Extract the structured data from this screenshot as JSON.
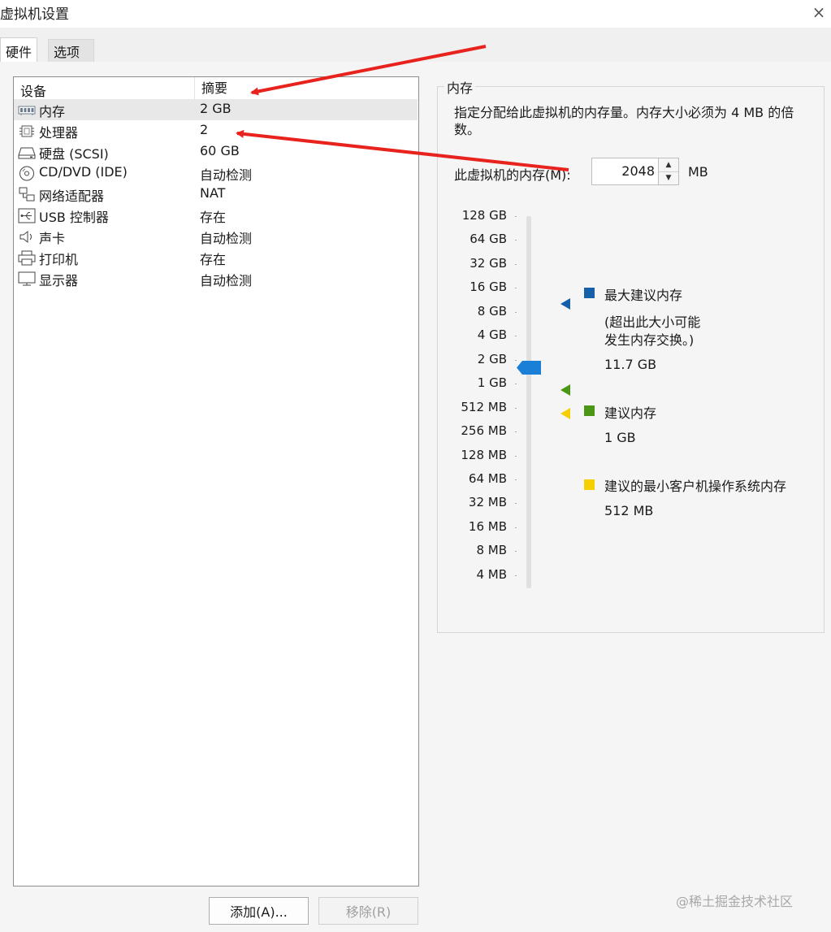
{
  "window": {
    "title": "虚拟机设置",
    "close_icon": "×"
  },
  "tabs": [
    {
      "label": "硬件",
      "active": true
    },
    {
      "label": "选项",
      "active": false
    }
  ],
  "device_table": {
    "headers": {
      "device": "设备",
      "summary": "摘要"
    },
    "rows": [
      {
        "name": "内存",
        "summary": "2 GB",
        "icon": "memory-icon",
        "selected": true
      },
      {
        "name": "处理器",
        "summary": "2",
        "icon": "processor-icon"
      },
      {
        "name": "硬盘 (SCSI)",
        "summary": "60 GB",
        "icon": "harddisk-icon"
      },
      {
        "name": "CD/DVD (IDE)",
        "summary": "自动检测",
        "icon": "cd-dvd-icon"
      },
      {
        "name": "网络适配器",
        "summary": "NAT",
        "icon": "network-adapter-icon"
      },
      {
        "name": "USB 控制器",
        "summary": "存在",
        "icon": "usb-icon"
      },
      {
        "name": "声卡",
        "summary": "自动检测",
        "icon": "speaker-icon"
      },
      {
        "name": "打印机",
        "summary": "存在",
        "icon": "printer-icon"
      },
      {
        "name": "显示器",
        "summary": "自动检测",
        "icon": "monitor-icon"
      }
    ]
  },
  "buttons": {
    "add": "添加(A)...",
    "remove": "移除(R)"
  },
  "memory": {
    "group_title": "内存",
    "description": "指定分配给此虚拟机的内存量。内存大小必须为 4 MB 的倍数。",
    "field_label": "此虚拟机的内存(M):",
    "value": "2048",
    "unit": "MB",
    "scale_labels": [
      "128 GB",
      "64 GB",
      "32 GB",
      "16 GB",
      "8 GB",
      "4 GB",
      "2 GB",
      "1 GB",
      "512 MB",
      "256 MB",
      "128 MB",
      "64 MB",
      "32 MB",
      "16 MB",
      "8 MB",
      "4 MB"
    ],
    "current_level": "2 GB",
    "legend": {
      "max": {
        "title": "最大建议内存",
        "note_line1": "(超出此大小可能",
        "note_line2": "发生内存交换。)",
        "value": "11.7 GB",
        "color": "#1560a8"
      },
      "recommended": {
        "title": "建议内存",
        "value": "1 GB",
        "color": "#4b9614"
      },
      "min_guest": {
        "title": "建议的最小客户机操作系统内存",
        "value": "512 MB",
        "color": "#f5cf00"
      }
    }
  },
  "watermark": "@稀土掘金技术社区",
  "colors": {
    "thumb": "#1a7fd6",
    "annotation_arrow": "#e8231e"
  }
}
